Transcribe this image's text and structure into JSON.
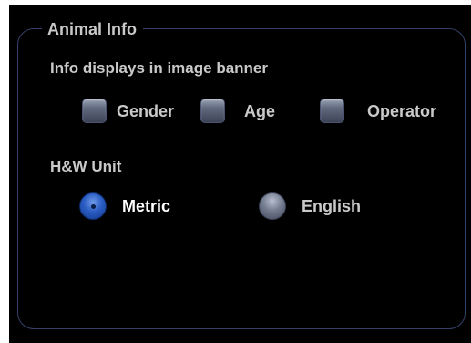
{
  "panel": {
    "title": "Animal Info"
  },
  "banner_section": {
    "heading": "Info displays in image banner",
    "options": [
      {
        "label": "Gender",
        "checked": false
      },
      {
        "label": "Age",
        "checked": false
      },
      {
        "label": "Operator",
        "checked": false
      }
    ]
  },
  "unit_section": {
    "heading": "H&W Unit",
    "options": [
      {
        "label": "Metric",
        "selected": true
      },
      {
        "label": "English",
        "selected": false
      }
    ]
  }
}
